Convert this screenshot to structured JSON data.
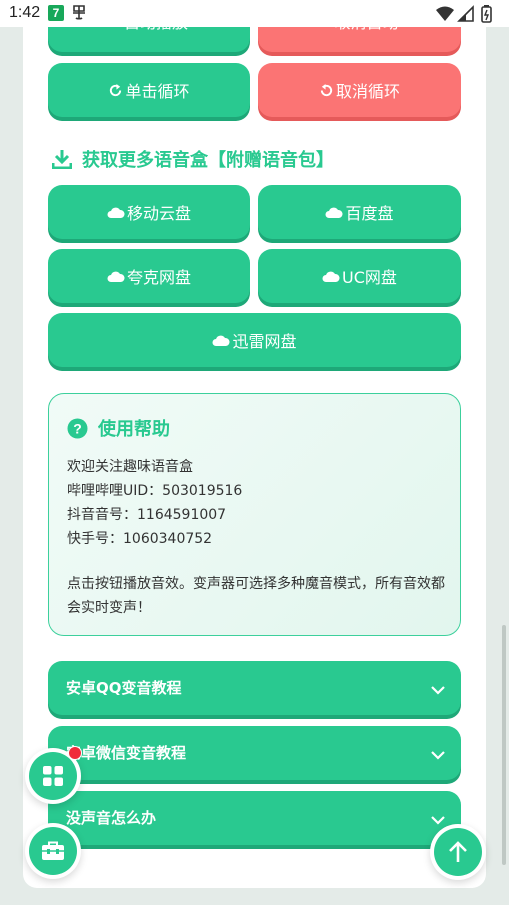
{
  "status_bar": {
    "time": "1:42",
    "notif_badge": "7"
  },
  "top_buttons": {
    "autoplay": "自动播放",
    "cancel_auto": "取消自动",
    "single_loop": "单击循环",
    "cancel_loop": "取消循环"
  },
  "download_section": {
    "title": "获取更多语音盒【附赠语音包】",
    "buttons": [
      "移动云盘",
      "百度盘",
      "夸克网盘",
      "UC网盘",
      "迅雷网盘"
    ]
  },
  "help": {
    "title": "使用帮助",
    "lines": [
      "欢迎关注趣味语音盒",
      "哔哩哔哩UID：503019516",
      "抖音音号：1164591007",
      "快手号：1060340752"
    ],
    "paragraph": "点击按钮播放音效。变声器可选择多种魔音模式，所有音效都会实时变声！"
  },
  "accordions": [
    "安卓QQ变音教程",
    "安卓微信变音教程",
    "没声音怎么办"
  ],
  "colors": {
    "accent": "#29c990",
    "danger": "#fb7474",
    "badge": "#f02b3a"
  },
  "icons": {
    "autoplay": "play-icon",
    "cancel_auto": "pause-icon",
    "single_loop": "redo-icon",
    "cancel_loop": "undo-icon",
    "section": "download-icon",
    "cloud": "cloud-icon",
    "help": "question-circle-icon",
    "accordion": "chevron-down-icon",
    "fab_menu": "grid-icon",
    "fab_tools": "toolbox-icon",
    "fab_top": "arrow-up-icon"
  }
}
